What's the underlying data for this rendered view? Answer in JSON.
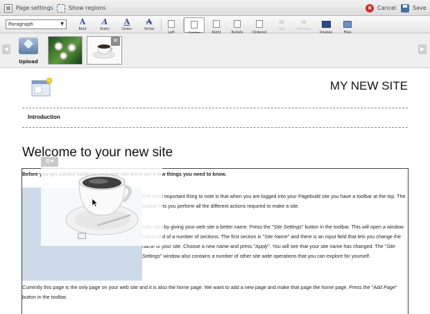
{
  "topbar": {
    "page_settings": "Page settings",
    "show_regions": "Show regions",
    "cancel": "Cancel",
    "save": "Save"
  },
  "toolbar": {
    "format_select": "Paragraph",
    "buttons": {
      "bold": "Bold",
      "italic": "Static",
      "underline": "Under",
      "strike": "Strike",
      "left": "Left",
      "center": "Center",
      "right": "Right",
      "bullets": "Bullets",
      "ordered": "Ordered",
      "link": "Link",
      "remove": "Remove",
      "images": "Images",
      "files": "Files"
    }
  },
  "strip": {
    "upload": "Upload"
  },
  "site": {
    "title": "MY NEW SITE",
    "nav_item": "Introduction",
    "heading": "Welcome to your new site",
    "para1": "Before you get started building your web site there are a few things you need to know.",
    "para2": "The most important thing to note is that when you are logged into your Pagebuild site you have a toolbar at the top. The toolbar lets you perform all the different actions required to make a site.",
    "para3_html": "Lets start by giving your web site a better name. Press the \"<i>Site Settings</i>\" button in the toolbar. This will open a window comprised of a number of sections. The first section is \"<i>Site Name</i>\" and there is an input field that lets you change the name of your site. Choose a new name and press \"<i>Apply</i>\". You will see that your site name has changed. The \"<i>Site Settings</i>\" window also contains a number of other site wide operations that you can explore for yourself.",
    "para4_html": "Currently this page is the only page on your web site and it is also the home page. We want to add a new page and make that page the home page. Press the \"<i>Add Page</i>\" button in the toolbar."
  },
  "colors": {
    "accent_blue": "#2a4f9e",
    "cancel_red": "#cc2b2b",
    "drop_highlight": "#becde2"
  }
}
